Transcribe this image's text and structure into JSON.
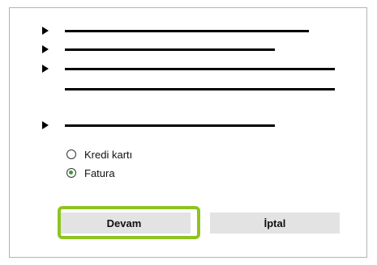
{
  "payment_options": [
    {
      "label": "Kredi kartı",
      "selected": false
    },
    {
      "label": "Fatura",
      "selected": true
    }
  ],
  "buttons": {
    "continue_label": "Devam",
    "cancel_label": "İptal"
  },
  "colors": {
    "highlight": "#8fc31f",
    "radio_selected": "#3a9a3a",
    "button_bg": "#e3e3e3"
  }
}
